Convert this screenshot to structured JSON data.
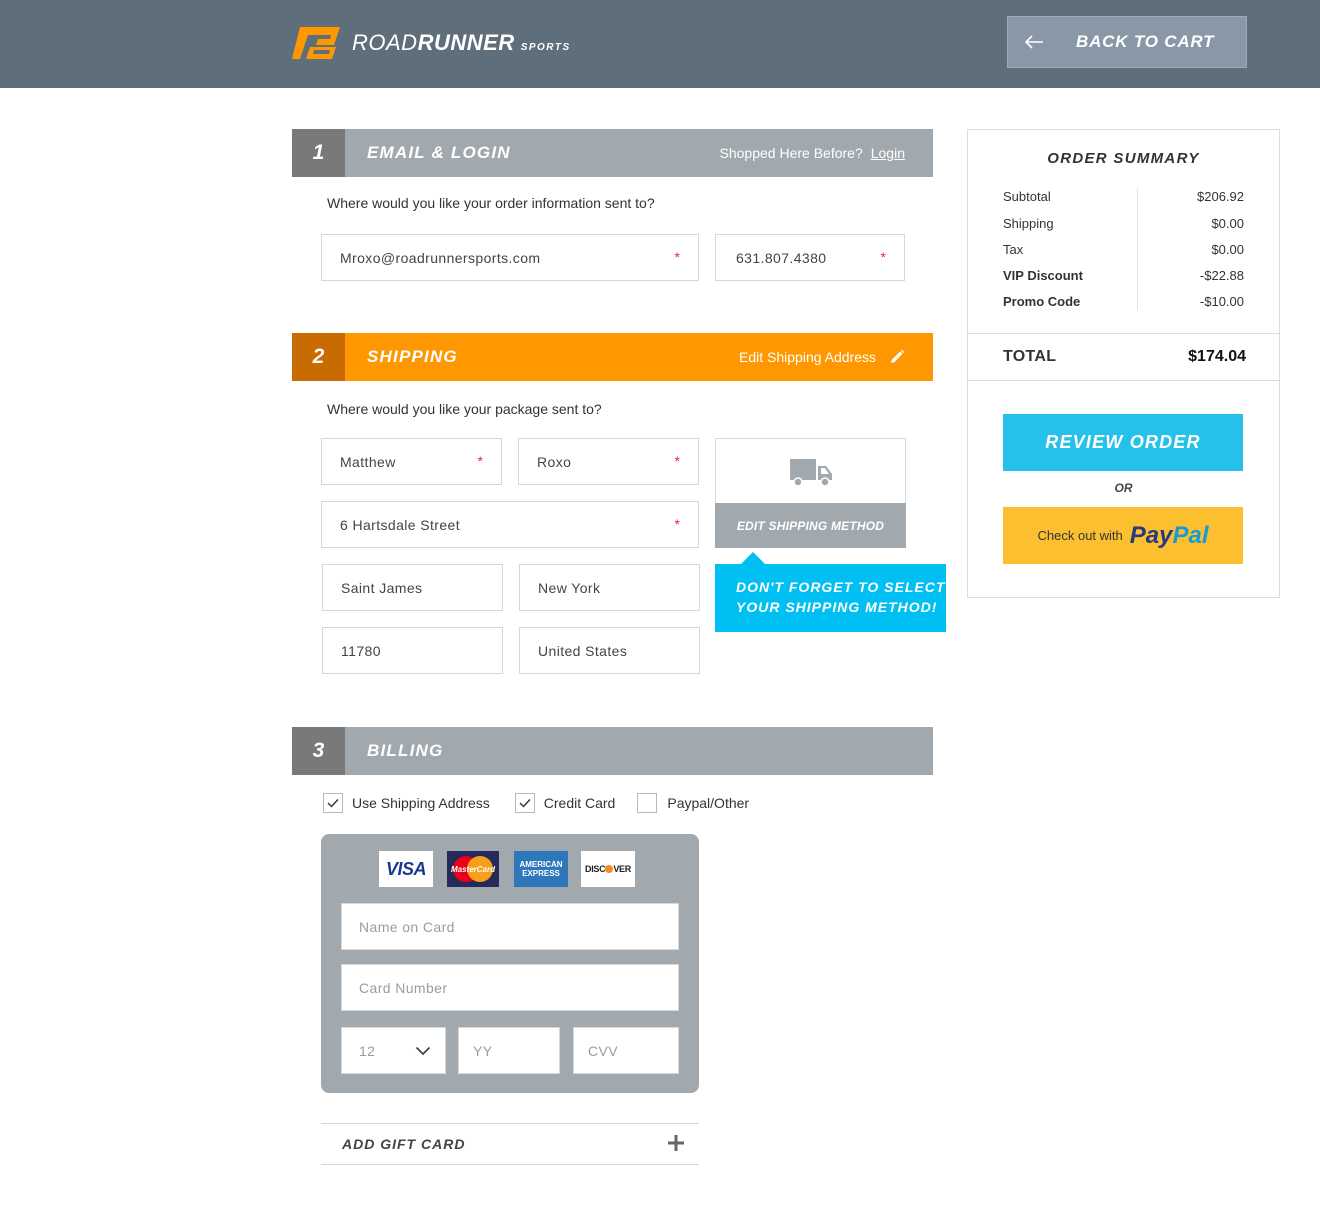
{
  "header": {
    "logo": {
      "road": "ROAD",
      "runner": "RUNNER",
      "sports": "SPORTS"
    },
    "back_to_cart": "BACK TO CART"
  },
  "section1": {
    "number": "1",
    "title": "EMAIL & LOGIN",
    "shopped_before": "Shopped Here Before?",
    "login_link": "Login",
    "question": "Where would you like your order information sent to?",
    "email": "Mroxo@roadrunnersports.com",
    "phone": "631.807.4380"
  },
  "section2": {
    "number": "2",
    "title": "SHIPPING",
    "edit_address": "Edit Shipping Address",
    "question": "Where would you like your package sent to?",
    "first_name": "Matthew",
    "last_name": "Roxo",
    "street": "6 Hartsdale Street",
    "city": "Saint James",
    "state": "New York",
    "zip": "11780",
    "country": "United States",
    "edit_method": "EDIT SHIPPING METHOD",
    "callout_line1": "DON'T FORGET TO SELECT",
    "callout_line2": "YOUR SHIPPING METHOD!"
  },
  "section3": {
    "number": "3",
    "title": "BILLING",
    "use_shipping": {
      "label": "Use Shipping Address",
      "checked": true
    },
    "credit_card": {
      "label": "Credit Card",
      "checked": true
    },
    "paypal_other": {
      "label": "Paypal/Other",
      "checked": false
    },
    "card_logos": {
      "visa": "VISA",
      "mastercard": "MasterCard",
      "amex_line1": "AMERICAN",
      "amex_line2": "EXPRESS",
      "discover_a": "DISC",
      "discover_b": "VER"
    },
    "name_placeholder": "Name on Card",
    "number_placeholder": "Card Number",
    "month": "12",
    "year_placeholder": "YY",
    "cvv_placeholder": "CVV",
    "gift_card": "ADD GIFT CARD"
  },
  "summary": {
    "heading": "ORDER SUMMARY",
    "rows": [
      {
        "label": "Subtotal",
        "value": "$206.92"
      },
      {
        "label": "Shipping",
        "value": "$0.00"
      },
      {
        "label": "Tax",
        "value": "$0.00"
      },
      {
        "label": "VIP Discount",
        "value": "-$22.88"
      },
      {
        "label": "Promo Code",
        "value": "-$10.00"
      }
    ],
    "total_label": "TOTAL",
    "total_value": "$174.04",
    "review_button": "REVIEW ORDER",
    "or": "OR",
    "paypal_prefix": "Check out with",
    "paypal_pay": "Pay",
    "paypal_pal": "Pal"
  },
  "colors": {
    "header_bg": "#5f6e7b",
    "brand_orange": "#ff9800",
    "review_blue": "#26c1ea",
    "callout_blue": "#00c0f3",
    "paypal_yellow": "#fcbf2f",
    "required_pink": "#e91e63"
  }
}
